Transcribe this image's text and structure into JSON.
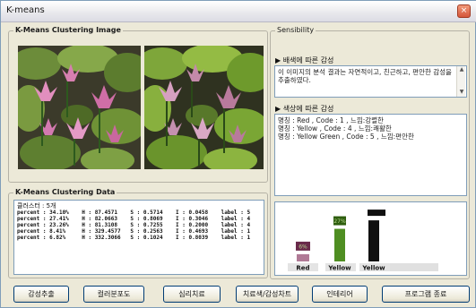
{
  "window": {
    "title": "K-means",
    "close_glyph": "×"
  },
  "left_panel": {
    "image_group_label": "K-Means Clustering Image",
    "data_group_label": "K-Means Clustering Data",
    "cluster_count_line": "클러스터 : 5개",
    "rows": [
      "percent : 34.10%    H : 87.4571    S : 0.5714    I : 0.0458    label : 5",
      "percent : 27.41%    H : 82.0663    S : 0.8069    I : 0.3046    label : 4",
      "percent : 23.26%    H : 81.3108    S : 0.7255    I : 0.2000    label : 4",
      "percent : 8.41%     H : 329.4577   S : 0.2563    I : 0.4693    label : 1",
      "percent : 6.82%     H : 332.3066   S : 0.1024    I : 0.8039    label : 1"
    ]
  },
  "right_panel": {
    "group_label": "Sensibility",
    "bg_heading": "▶ 배색에 따른 감성",
    "bg_text": "이 이미지의 분석 결과는 자연적이고, 친근하고, 편안한 감성을 추출하였다.",
    "color_heading": "▶ 색상에 따른 감성",
    "color_lines": [
      "명칭 : Red ,  Code : 1 ,   느낌:강렬한",
      "명칭 : Yellow ,  Code : 4 ,   느낌:쾌활한",
      "명칭 : Yellow Green ,  Code : 5 ,   느낌:편안한"
    ]
  },
  "chart_data": {
    "type": "bar",
    "categories": [
      "Red",
      "Yellow",
      "Yellow",
      ""
    ],
    "values": [
      6,
      27,
      34,
      0
    ],
    "data_labels": [
      "6%",
      "27%",
      ""
    ],
    "colors": [
      "#b07a96",
      "#4f8e22",
      "#101010",
      "#e0e0e0"
    ],
    "cap_colors": [
      "#6a2a4a",
      "#2e5e0e",
      "#101010"
    ]
  },
  "buttons": [
    {
      "label": "감성추출"
    },
    {
      "label": "컬러분포도"
    },
    {
      "label": "심리치료"
    },
    {
      "label": "치료색/감성차트"
    },
    {
      "label": "인테리어"
    },
    {
      "label": "프로그램 종료"
    }
  ]
}
